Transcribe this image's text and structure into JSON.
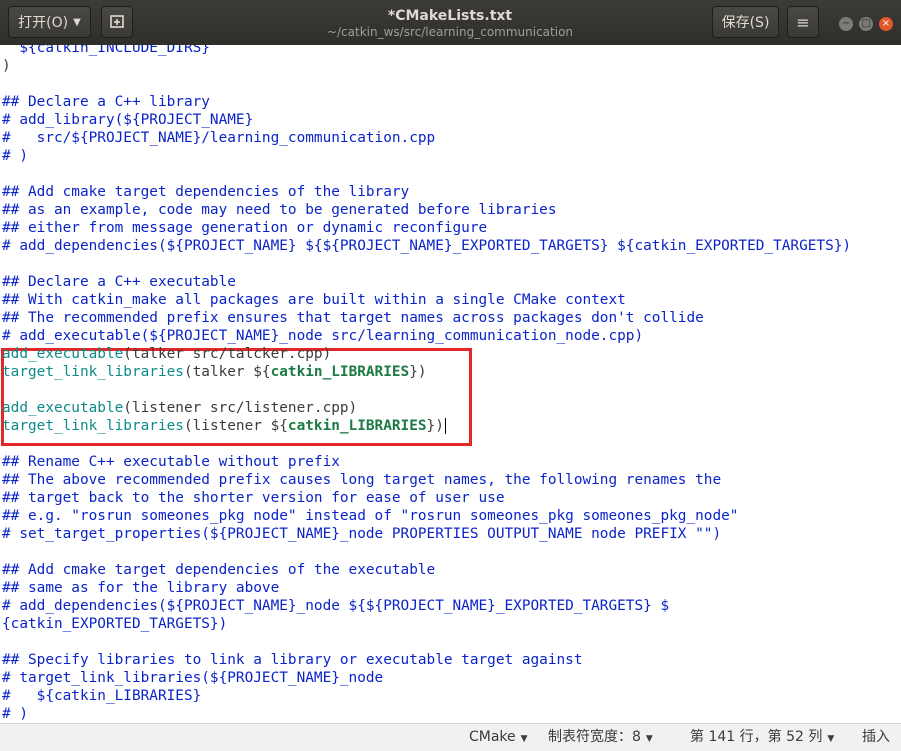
{
  "header": {
    "open_label": "打开(O)",
    "title": "*CMakeLists.txt",
    "subtitle": "~/catkin_ws/src/learning_communication",
    "save_label": "保存(S)"
  },
  "editor": {
    "lines": [
      [
        [
          "cmt",
          "  ${catkin_INCLUDE_DIRS}"
        ]
      ],
      [
        [
          "txt",
          ")"
        ]
      ],
      [
        [
          "txt",
          ""
        ]
      ],
      [
        [
          "cmt",
          "## Declare a C++ library"
        ]
      ],
      [
        [
          "cmt",
          "# add_library(${PROJECT_NAME}"
        ]
      ],
      [
        [
          "cmt",
          "#   src/${PROJECT_NAME}/learning_communication.cpp"
        ]
      ],
      [
        [
          "cmt",
          "# )"
        ]
      ],
      [
        [
          "txt",
          ""
        ]
      ],
      [
        [
          "cmt",
          "## Add cmake target dependencies of the library"
        ]
      ],
      [
        [
          "cmt",
          "## as an example, code may need to be generated before libraries"
        ]
      ],
      [
        [
          "cmt",
          "## either from message generation or dynamic reconfigure"
        ]
      ],
      [
        [
          "cmt",
          "# add_dependencies(${PROJECT_NAME} ${${PROJECT_NAME}_EXPORTED_TARGETS} ${catkin_EXPORTED_TARGETS})"
        ]
      ],
      [
        [
          "txt",
          ""
        ]
      ],
      [
        [
          "cmt",
          "## Declare a C++ executable"
        ]
      ],
      [
        [
          "cmt",
          "## With catkin_make all packages are built within a single CMake context"
        ]
      ],
      [
        [
          "cmt",
          "## The recommended prefix ensures that target names across packages don't collide"
        ]
      ],
      [
        [
          "cmt",
          "# add_executable(${PROJECT_NAME}_node src/learning_communication_node.cpp)"
        ]
      ],
      [
        [
          "fn",
          "add_executable"
        ],
        [
          "txt",
          "(talker src/talcker.cpp)"
        ]
      ],
      [
        [
          "fn",
          "target_link_libraries"
        ],
        [
          "txt",
          "(talker ${"
        ],
        [
          "var",
          "catkin_LIBRARIES"
        ],
        [
          "txt",
          "})"
        ]
      ],
      [
        [
          "txt",
          ""
        ]
      ],
      [
        [
          "fn",
          "add_executable"
        ],
        [
          "txt",
          "(listener src/listener.cpp)"
        ]
      ],
      [
        [
          "fn",
          "target_link_libraries"
        ],
        [
          "txt",
          "(listener ${"
        ],
        [
          "var",
          "catkin_LIBRARIES"
        ],
        [
          "txt",
          "})"
        ]
      ],
      [
        [
          "txt",
          ""
        ]
      ],
      [
        [
          "cmt",
          "## Rename C++ executable without prefix"
        ]
      ],
      [
        [
          "cmt",
          "## The above recommended prefix causes long target names, the following renames the"
        ]
      ],
      [
        [
          "cmt",
          "## target back to the shorter version for ease of user use"
        ]
      ],
      [
        [
          "cmt",
          "## e.g. \"rosrun someones_pkg node\" instead of \"rosrun someones_pkg someones_pkg_node\""
        ]
      ],
      [
        [
          "cmt",
          "# set_target_properties(${PROJECT_NAME}_node PROPERTIES OUTPUT_NAME node PREFIX \"\")"
        ]
      ],
      [
        [
          "txt",
          ""
        ]
      ],
      [
        [
          "cmt",
          "## Add cmake target dependencies of the executable"
        ]
      ],
      [
        [
          "cmt",
          "## same as for the library above"
        ]
      ],
      [
        [
          "cmt",
          "# add_dependencies(${PROJECT_NAME}_node ${${PROJECT_NAME}_EXPORTED_TARGETS} $"
        ]
      ],
      [
        [
          "cmt",
          "{catkin_EXPORTED_TARGETS})"
        ]
      ],
      [
        [
          "txt",
          ""
        ]
      ],
      [
        [
          "cmt",
          "## Specify libraries to link a library or executable target against"
        ]
      ],
      [
        [
          "cmt",
          "# target_link_libraries(${PROJECT_NAME}_node"
        ]
      ],
      [
        [
          "cmt",
          "#   ${catkin_LIBRARIES}"
        ]
      ],
      [
        [
          "cmt",
          "# )"
        ]
      ]
    ]
  },
  "statusbar": {
    "language": "CMake",
    "tab_width": "制表符宽度：8",
    "position": "第 141 行，第 52 列",
    "mode": "插入"
  },
  "colors": {
    "comment": "#0b24c9",
    "function": "#0d8b8b",
    "variable": "#1e7a45",
    "highlight_border": "#e32626",
    "close_button": "#e2582b"
  },
  "icons": [
    "pin-icon",
    "hamburger-menu-icon",
    "minimize-icon",
    "maximize-icon",
    "close-icon",
    "chevron-down-icon"
  ]
}
